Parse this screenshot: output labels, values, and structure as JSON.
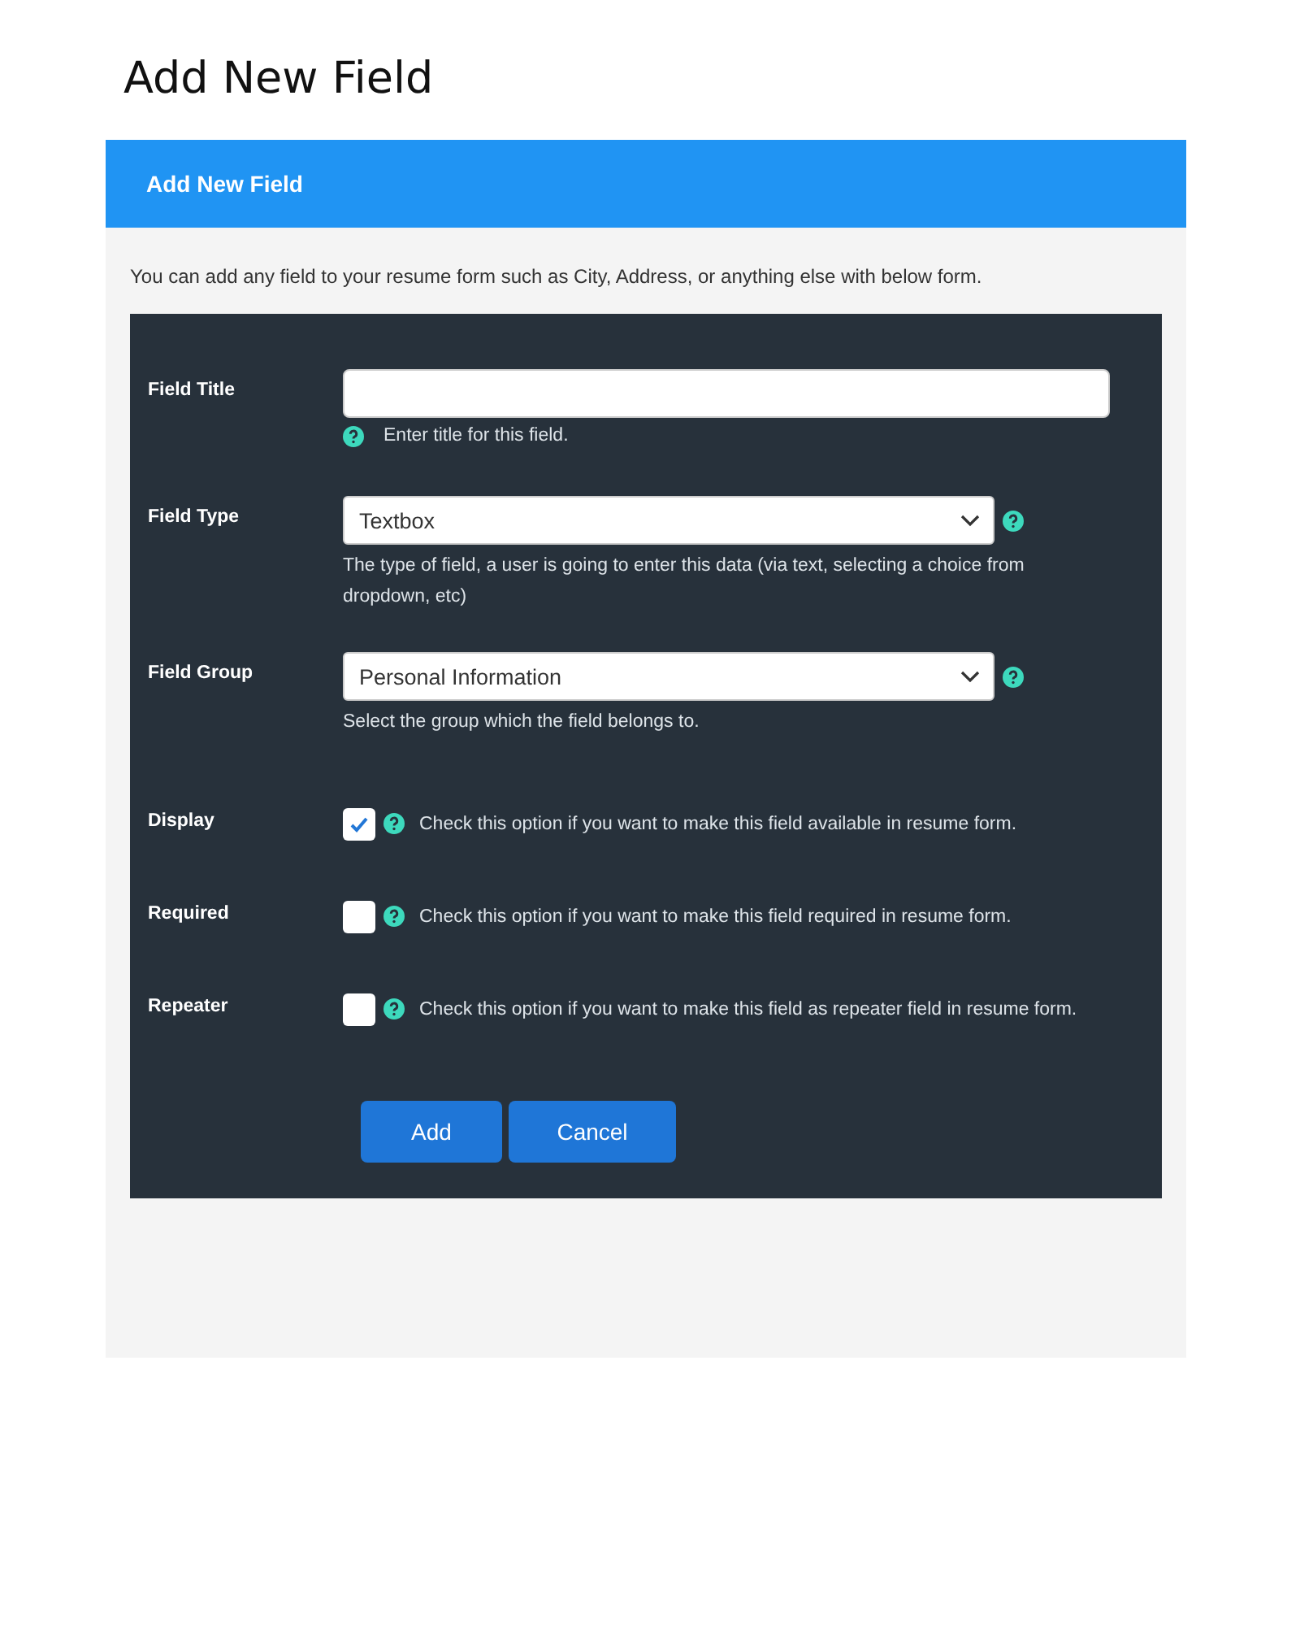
{
  "page_title": "Add New Field",
  "panel": {
    "title": "Add New Field",
    "description": "You can add any field to your resume form such as City, Address, or anything else with below form."
  },
  "fields": [
    {
      "kind": "text",
      "label": "Field Title",
      "help": "Enter title for this field."
    },
    {
      "kind": "select",
      "label": "Field Type",
      "value": "Textbox",
      "help": "The type of field, a user is going to enter this data (via text, selecting a choice from dropdown, etc)"
    },
    {
      "kind": "select",
      "label": "Field Group",
      "value": "Personal Information",
      "help": "Select the group which the field belongs to."
    },
    {
      "kind": "checkbox",
      "label": "Display",
      "checked": true,
      "help": "Check this option if you want to make this field available in resume form."
    },
    {
      "kind": "checkbox",
      "label": "Required",
      "checked": false,
      "help": "Check this option if you want to make this field required in resume form."
    },
    {
      "kind": "checkbox",
      "label": "Repeater",
      "checked": false,
      "help": "Check this option if you want to make this field as repeater field in resume form."
    }
  ],
  "buttons": [
    "Add",
    "Cancel"
  ]
}
